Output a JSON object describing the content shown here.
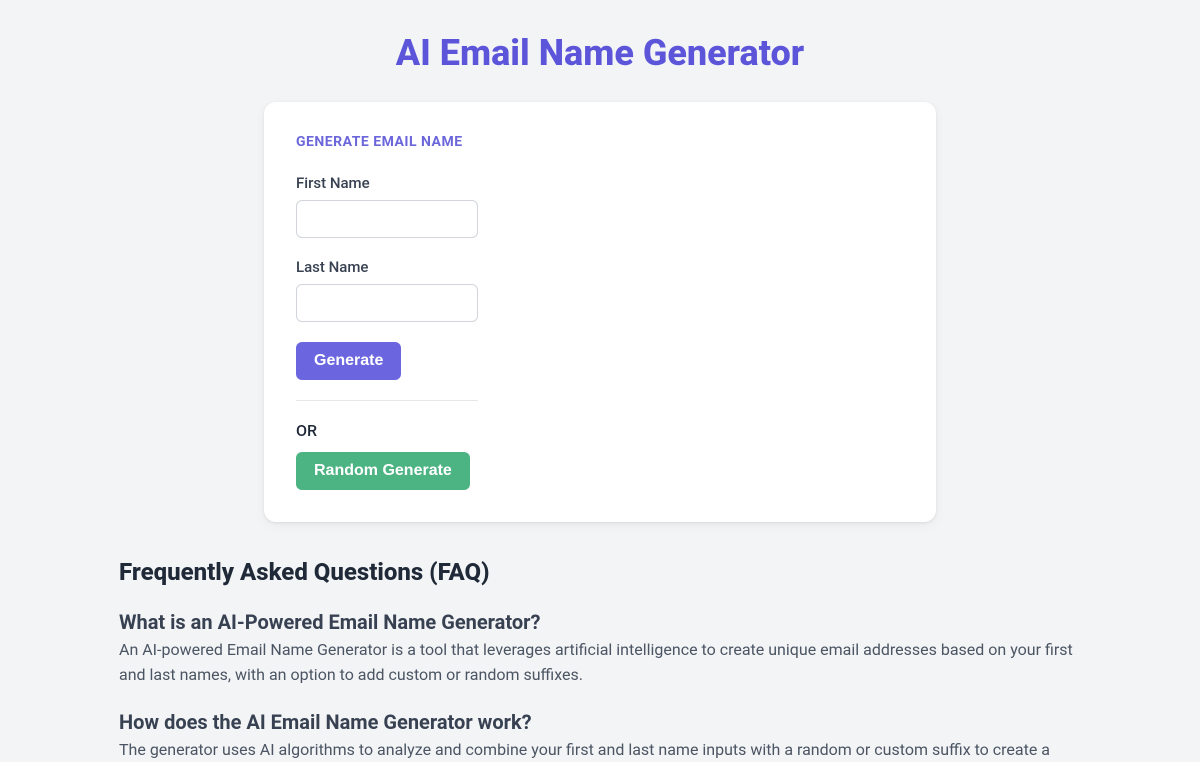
{
  "page": {
    "title": "AI Email Name Generator"
  },
  "card": {
    "heading": "GENERATE EMAIL NAME",
    "first_name_label": "First Name",
    "first_name_value": "",
    "last_name_label": "Last Name",
    "last_name_value": "",
    "generate_button": "Generate",
    "or_text": "OR",
    "random_button": "Random Generate"
  },
  "faq": {
    "heading": "Frequently Asked Questions (FAQ)",
    "items": [
      {
        "question": "What is an AI-Powered Email Name Generator?",
        "answer": "An AI-powered Email Name Generator is a tool that leverages artificial intelligence to create unique email addresses based on your first and last names, with an option to add custom or random suffixes."
      },
      {
        "question": "How does the AI Email Name Generator work?",
        "answer": "The generator uses AI algorithms to analyze and combine your first and last name inputs with a random or custom suffix to create a"
      }
    ]
  }
}
